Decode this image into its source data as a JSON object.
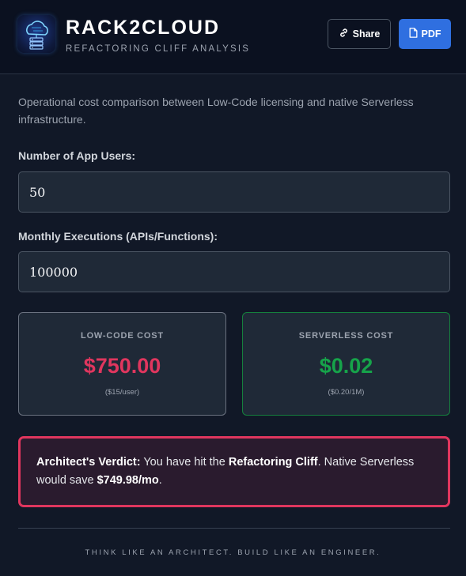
{
  "header": {
    "title": "RACK2CLOUD",
    "subtitle": "REFACTORING CLIFF ANALYSIS",
    "logo_icon": "cloud-server-icon",
    "share_label": "Share",
    "pdf_label": "PDF"
  },
  "intro": "Operational cost comparison between Low-Code licensing and native Serverless infrastructure.",
  "inputs": {
    "users_label": "Number of App Users:",
    "users_value": "50",
    "executions_label": "Monthly Executions (APIs/Functions):",
    "executions_value": "100000"
  },
  "cards": {
    "low_code": {
      "title": "LOW-CODE COST",
      "value": "$750.00",
      "note": "($15/user)"
    },
    "serverless": {
      "title": "SERVERLESS COST",
      "value": "$0.02",
      "note": "($0.20/1M)"
    }
  },
  "verdict": {
    "lead": "Architect's Verdict:",
    "text1": " You have hit the ",
    "highlight": "Refactoring Cliff",
    "text2": ". Native Serverless would save ",
    "savings": "$749.98/mo",
    "text3": "."
  },
  "footer": "THINK LIKE AN ARCHITECT. BUILD LIKE AN ENGINEER.",
  "colors": {
    "accent_blue": "#2f6fe0",
    "low_code_red": "#e0365e",
    "serverless_green": "#16a34a",
    "background": "#111827"
  }
}
